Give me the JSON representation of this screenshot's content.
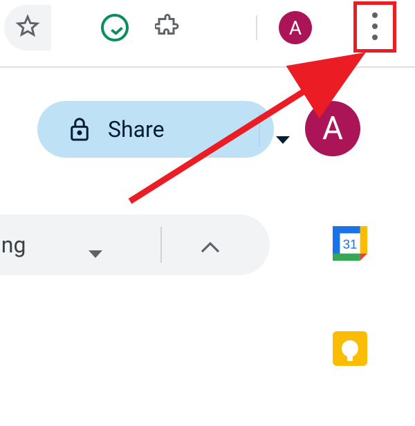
{
  "toolbar": {
    "avatar_initial": "A",
    "colors": {
      "avatar": "#ab1457",
      "highlight": "#ec1c24",
      "grammarly": "#0a8f5b"
    }
  },
  "app": {
    "share_label": "Share",
    "avatar_initial": "A",
    "editing_label": "ing",
    "calendar_day": "31"
  }
}
